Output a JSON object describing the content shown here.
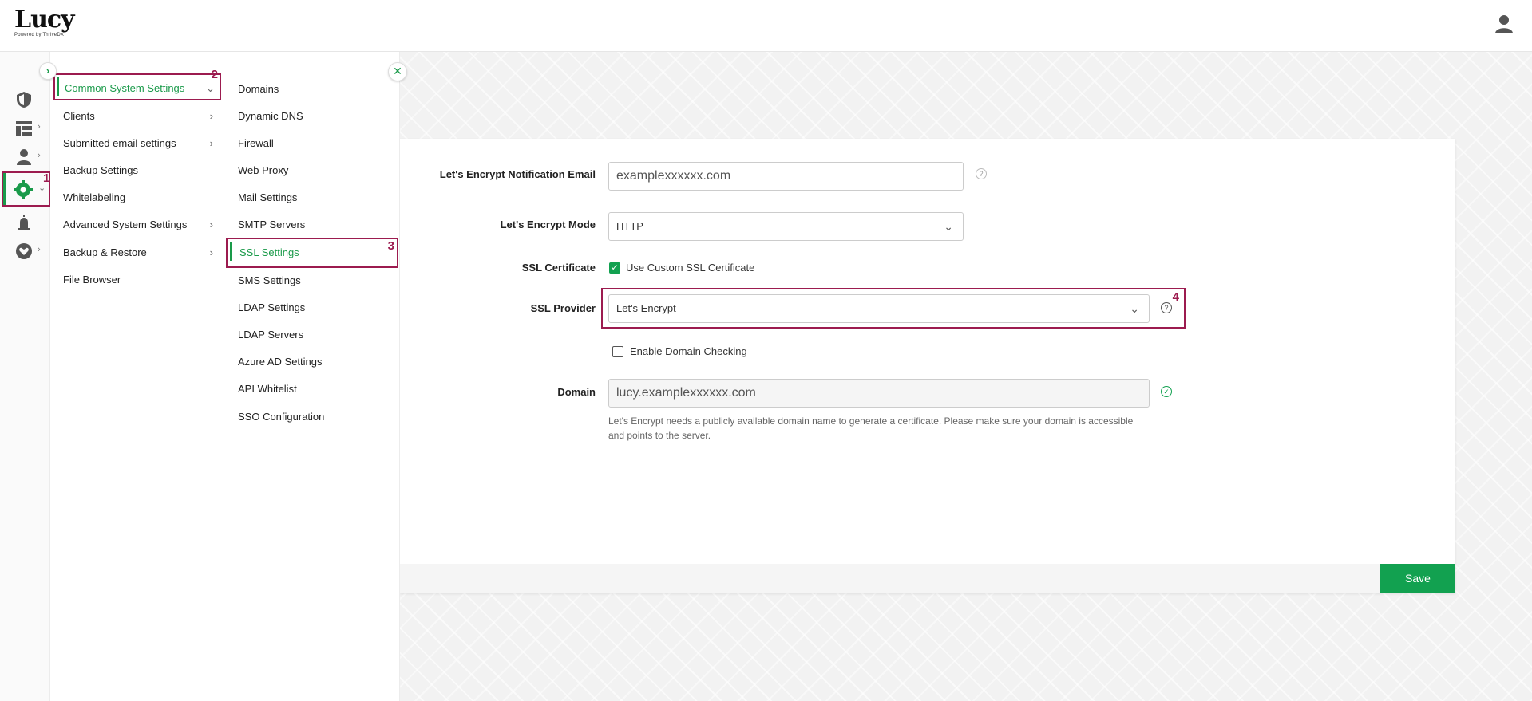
{
  "header": {
    "logo_text": "Lucy",
    "logo_subtext": "Powered by ThriveDX"
  },
  "rail": {
    "items": [
      {
        "icon": "shield-icon"
      },
      {
        "icon": "dashboard-icon"
      },
      {
        "icon": "users-icon"
      },
      {
        "icon": "settings-gear-icon"
      },
      {
        "icon": "alarm-icon"
      },
      {
        "icon": "heart-icon"
      }
    ],
    "active_index": 3
  },
  "annotations": {
    "n1": "1",
    "n2": "2",
    "n3": "3",
    "n4": "4"
  },
  "menu1": {
    "items": [
      {
        "label": "Common System Settings"
      },
      {
        "label": "Clients"
      },
      {
        "label": "Submitted email settings"
      },
      {
        "label": "Backup Settings"
      },
      {
        "label": "Whitelabeling"
      },
      {
        "label": "Advanced System Settings"
      },
      {
        "label": "Backup & Restore"
      },
      {
        "label": "File Browser"
      }
    ]
  },
  "menu2": {
    "items": [
      {
        "label": "Domains"
      },
      {
        "label": "Dynamic DNS"
      },
      {
        "label": "Firewall"
      },
      {
        "label": "Web Proxy"
      },
      {
        "label": "Mail Settings"
      },
      {
        "label": "SMTP Servers"
      },
      {
        "label": "SSL Settings"
      },
      {
        "label": "SMS Settings"
      },
      {
        "label": "LDAP Settings"
      },
      {
        "label": "LDAP Servers"
      },
      {
        "label": "Azure AD Settings"
      },
      {
        "label": "API Whitelist"
      },
      {
        "label": "SSO Configuration"
      }
    ]
  },
  "form": {
    "notification_email_label": "Let's Encrypt Notification Email",
    "notification_email_value": "examplexxxxxx.com",
    "mode_label": "Let's Encrypt Mode",
    "mode_value": "HTTP",
    "ssl_certificate_label": "SSL Certificate",
    "use_custom_ssl_label": "Use Custom SSL Certificate",
    "use_custom_ssl_checked": true,
    "ssl_provider_label": "SSL Provider",
    "ssl_provider_value": "Let's Encrypt",
    "enable_domain_checking_label": "Enable Domain Checking",
    "enable_domain_checking_checked": false,
    "domain_label": "Domain",
    "domain_value": "lucy.examplexxxxxx.com",
    "domain_hint": "Let's Encrypt needs a publicly available domain name to generate a certificate. Please make sure your domain is accessible and points to the server.",
    "help_glyph": "?",
    "save_label": "Save"
  },
  "colors": {
    "accent_green": "#12a150",
    "annotation_red": "#9c1b4f"
  }
}
